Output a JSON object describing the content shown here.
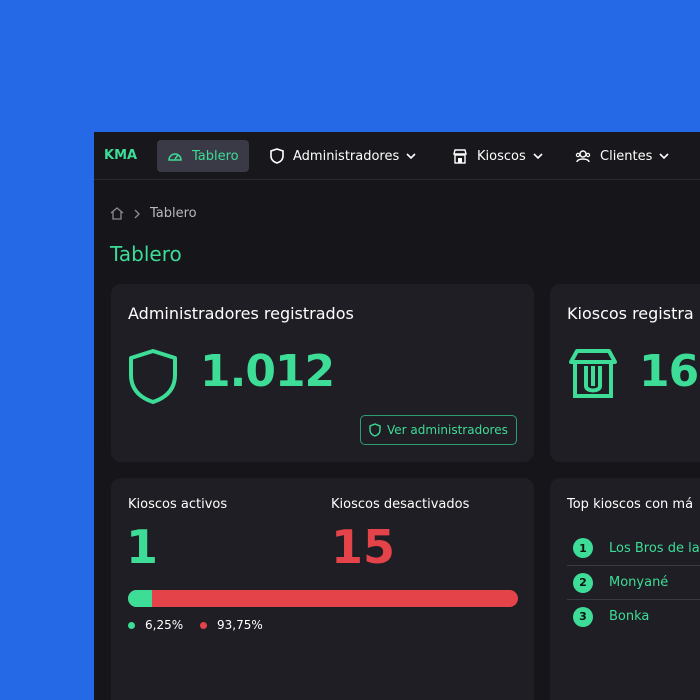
{
  "brand": "KMA",
  "nav": {
    "dashboard": "Tablero",
    "admins": "Administradores",
    "kiosks": "Kioscos",
    "clients": "Clientes"
  },
  "breadcrumb": {
    "current": "Tablero"
  },
  "page_title": "Tablero",
  "admins_card": {
    "title": "Administradores registrados",
    "count": "1.012",
    "button": "Ver administradores"
  },
  "kiosks_card": {
    "title": "Kioscos registra",
    "count": "16"
  },
  "status_card": {
    "active_label": "Kioscos activos",
    "active_count": "1",
    "inactive_label": "Kioscos desactivados",
    "inactive_count": "15",
    "active_percent": "6,25%",
    "inactive_percent": "93,75%",
    "active_fraction": 0.0625
  },
  "top_card": {
    "title": "Top kioscos con má",
    "items": [
      {
        "rank": "1",
        "name": "Los Bros de la"
      },
      {
        "rank": "2",
        "name": "Monyané"
      },
      {
        "rank": "3",
        "name": "Bonka"
      }
    ]
  },
  "colors": {
    "accent": "#3ddc97",
    "danger": "#e5434a",
    "background": "#2569e6"
  }
}
